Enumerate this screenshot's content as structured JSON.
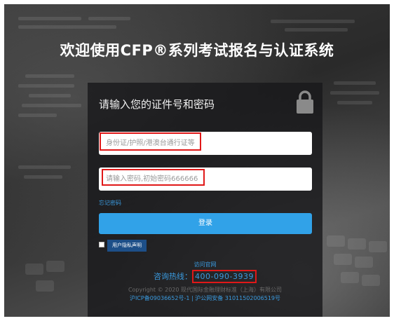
{
  "page": {
    "title": "欢迎使用CFP®系列考试报名与认证系统"
  },
  "panel": {
    "heading": "请输入您的证件号和密码",
    "lock_icon": "lock-icon",
    "id_field": {
      "placeholder": "身份证/护照/港澳台通行证等",
      "value": ""
    },
    "password_field": {
      "placeholder": "请输入密码,初始密码666666",
      "value": ""
    },
    "forgot_link": "忘记密码",
    "login_button": "登录",
    "agree_checked": false,
    "privacy_button": "用户隐私声明"
  },
  "footer": {
    "site_link": "访问官网",
    "hotline_label": "咨询热线：",
    "hotline_number": "400-090-3939",
    "copyright": "Copyright © 2020 现代国际金融理财标准（上海）有限公司",
    "icp": "沪ICP备09036652号-1",
    "separator": "|",
    "police": "沪公网安备 31011502006519号"
  },
  "colors": {
    "accent": "#31a2e8",
    "link": "#3a9be0",
    "highlight": "#e01818",
    "privacy_button": "#1d4f88"
  }
}
